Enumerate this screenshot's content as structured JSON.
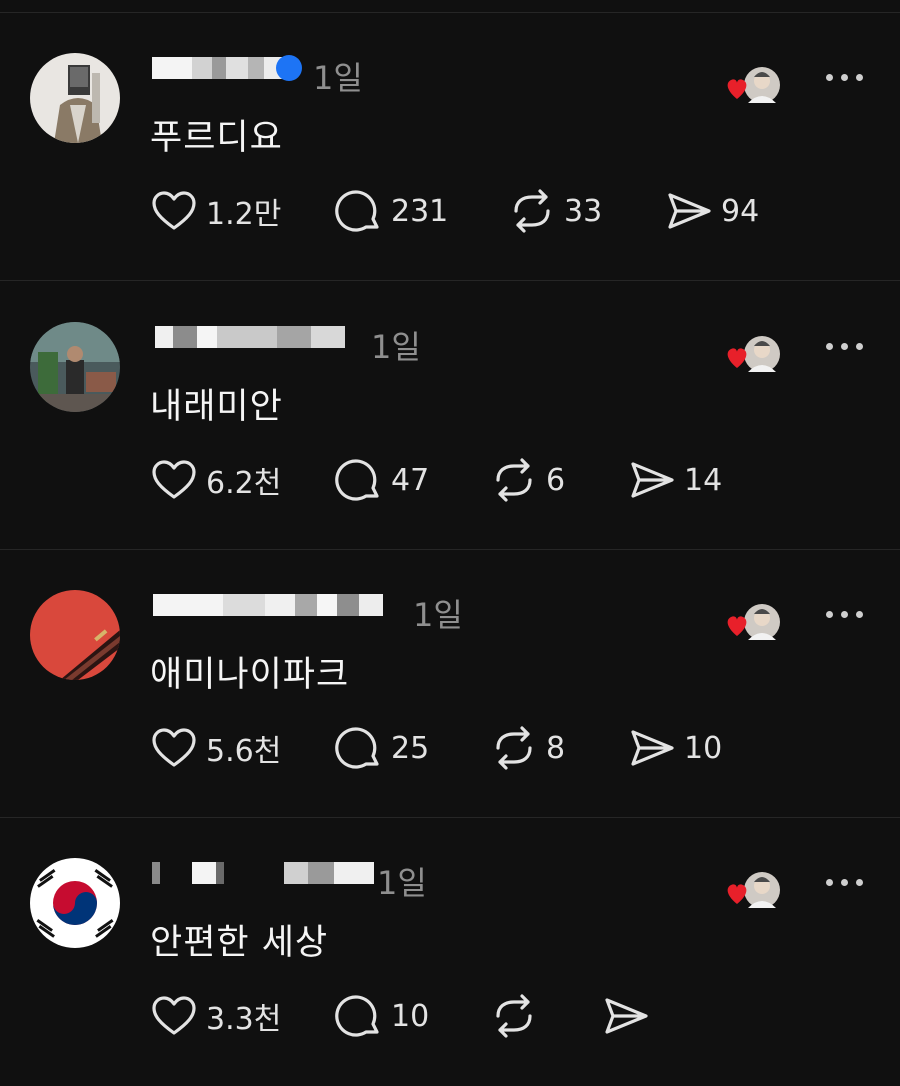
{
  "colors": {
    "background": "#101010",
    "text": "#f5f5f5",
    "muted": "#8f8f8f",
    "heart": "#e8202a",
    "divider": "#262626",
    "verified": "#1d74f5"
  },
  "posts": [
    {
      "time": "1일",
      "text": "푸르디요",
      "likes": "1.2만",
      "comments": "231",
      "reposts": "33",
      "shares": "94",
      "avatar": "person-photo",
      "verified": true
    },
    {
      "time": "1일",
      "text": "내래미안",
      "likes": "6.2천",
      "comments": "47",
      "reposts": "6",
      "shares": "14",
      "avatar": "street-photo",
      "verified": false
    },
    {
      "time": "1일",
      "text": "애미나이파크",
      "likes": "5.6천",
      "comments": "25",
      "reposts": "8",
      "shares": "10",
      "avatar": "guitar-photo",
      "verified": false
    },
    {
      "time": "1일",
      "text": "안편한 세상",
      "likes": "3.3천",
      "comments": "10",
      "reposts": "",
      "shares": "",
      "avatar": "korean-flag",
      "verified": false
    }
  ]
}
